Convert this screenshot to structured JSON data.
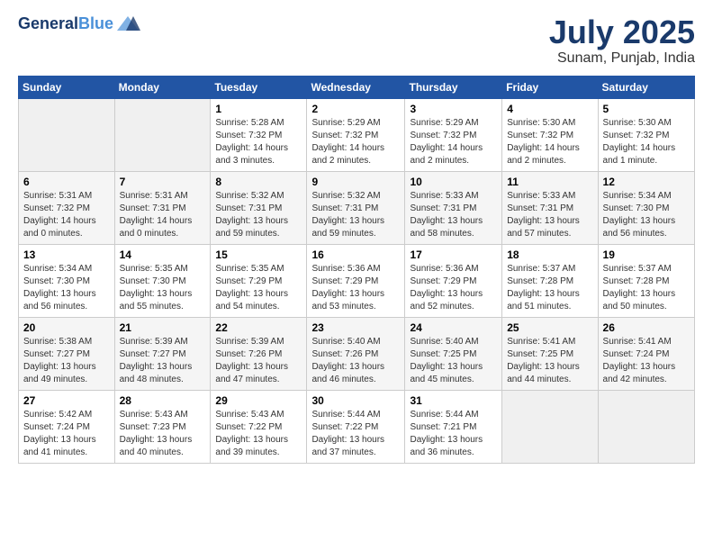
{
  "header": {
    "logo_line1": "General",
    "logo_line2": "Blue",
    "month_title": "July 2025",
    "location": "Sunam, Punjab, India"
  },
  "weekdays": [
    "Sunday",
    "Monday",
    "Tuesday",
    "Wednesday",
    "Thursday",
    "Friday",
    "Saturday"
  ],
  "weeks": [
    [
      {
        "day": "",
        "info": ""
      },
      {
        "day": "",
        "info": ""
      },
      {
        "day": "1",
        "info": "Sunrise: 5:28 AM\nSunset: 7:32 PM\nDaylight: 14 hours\nand 3 minutes."
      },
      {
        "day": "2",
        "info": "Sunrise: 5:29 AM\nSunset: 7:32 PM\nDaylight: 14 hours\nand 2 minutes."
      },
      {
        "day": "3",
        "info": "Sunrise: 5:29 AM\nSunset: 7:32 PM\nDaylight: 14 hours\nand 2 minutes."
      },
      {
        "day": "4",
        "info": "Sunrise: 5:30 AM\nSunset: 7:32 PM\nDaylight: 14 hours\nand 2 minutes."
      },
      {
        "day": "5",
        "info": "Sunrise: 5:30 AM\nSunset: 7:32 PM\nDaylight: 14 hours\nand 1 minute."
      }
    ],
    [
      {
        "day": "6",
        "info": "Sunrise: 5:31 AM\nSunset: 7:32 PM\nDaylight: 14 hours\nand 0 minutes."
      },
      {
        "day": "7",
        "info": "Sunrise: 5:31 AM\nSunset: 7:31 PM\nDaylight: 14 hours\nand 0 minutes."
      },
      {
        "day": "8",
        "info": "Sunrise: 5:32 AM\nSunset: 7:31 PM\nDaylight: 13 hours\nand 59 minutes."
      },
      {
        "day": "9",
        "info": "Sunrise: 5:32 AM\nSunset: 7:31 PM\nDaylight: 13 hours\nand 59 minutes."
      },
      {
        "day": "10",
        "info": "Sunrise: 5:33 AM\nSunset: 7:31 PM\nDaylight: 13 hours\nand 58 minutes."
      },
      {
        "day": "11",
        "info": "Sunrise: 5:33 AM\nSunset: 7:31 PM\nDaylight: 13 hours\nand 57 minutes."
      },
      {
        "day": "12",
        "info": "Sunrise: 5:34 AM\nSunset: 7:30 PM\nDaylight: 13 hours\nand 56 minutes."
      }
    ],
    [
      {
        "day": "13",
        "info": "Sunrise: 5:34 AM\nSunset: 7:30 PM\nDaylight: 13 hours\nand 56 minutes."
      },
      {
        "day": "14",
        "info": "Sunrise: 5:35 AM\nSunset: 7:30 PM\nDaylight: 13 hours\nand 55 minutes."
      },
      {
        "day": "15",
        "info": "Sunrise: 5:35 AM\nSunset: 7:29 PM\nDaylight: 13 hours\nand 54 minutes."
      },
      {
        "day": "16",
        "info": "Sunrise: 5:36 AM\nSunset: 7:29 PM\nDaylight: 13 hours\nand 53 minutes."
      },
      {
        "day": "17",
        "info": "Sunrise: 5:36 AM\nSunset: 7:29 PM\nDaylight: 13 hours\nand 52 minutes."
      },
      {
        "day": "18",
        "info": "Sunrise: 5:37 AM\nSunset: 7:28 PM\nDaylight: 13 hours\nand 51 minutes."
      },
      {
        "day": "19",
        "info": "Sunrise: 5:37 AM\nSunset: 7:28 PM\nDaylight: 13 hours\nand 50 minutes."
      }
    ],
    [
      {
        "day": "20",
        "info": "Sunrise: 5:38 AM\nSunset: 7:27 PM\nDaylight: 13 hours\nand 49 minutes."
      },
      {
        "day": "21",
        "info": "Sunrise: 5:39 AM\nSunset: 7:27 PM\nDaylight: 13 hours\nand 48 minutes."
      },
      {
        "day": "22",
        "info": "Sunrise: 5:39 AM\nSunset: 7:26 PM\nDaylight: 13 hours\nand 47 minutes."
      },
      {
        "day": "23",
        "info": "Sunrise: 5:40 AM\nSunset: 7:26 PM\nDaylight: 13 hours\nand 46 minutes."
      },
      {
        "day": "24",
        "info": "Sunrise: 5:40 AM\nSunset: 7:25 PM\nDaylight: 13 hours\nand 45 minutes."
      },
      {
        "day": "25",
        "info": "Sunrise: 5:41 AM\nSunset: 7:25 PM\nDaylight: 13 hours\nand 44 minutes."
      },
      {
        "day": "26",
        "info": "Sunrise: 5:41 AM\nSunset: 7:24 PM\nDaylight: 13 hours\nand 42 minutes."
      }
    ],
    [
      {
        "day": "27",
        "info": "Sunrise: 5:42 AM\nSunset: 7:24 PM\nDaylight: 13 hours\nand 41 minutes."
      },
      {
        "day": "28",
        "info": "Sunrise: 5:43 AM\nSunset: 7:23 PM\nDaylight: 13 hours\nand 40 minutes."
      },
      {
        "day": "29",
        "info": "Sunrise: 5:43 AM\nSunset: 7:22 PM\nDaylight: 13 hours\nand 39 minutes."
      },
      {
        "day": "30",
        "info": "Sunrise: 5:44 AM\nSunset: 7:22 PM\nDaylight: 13 hours\nand 37 minutes."
      },
      {
        "day": "31",
        "info": "Sunrise: 5:44 AM\nSunset: 7:21 PM\nDaylight: 13 hours\nand 36 minutes."
      },
      {
        "day": "",
        "info": ""
      },
      {
        "day": "",
        "info": ""
      }
    ]
  ]
}
